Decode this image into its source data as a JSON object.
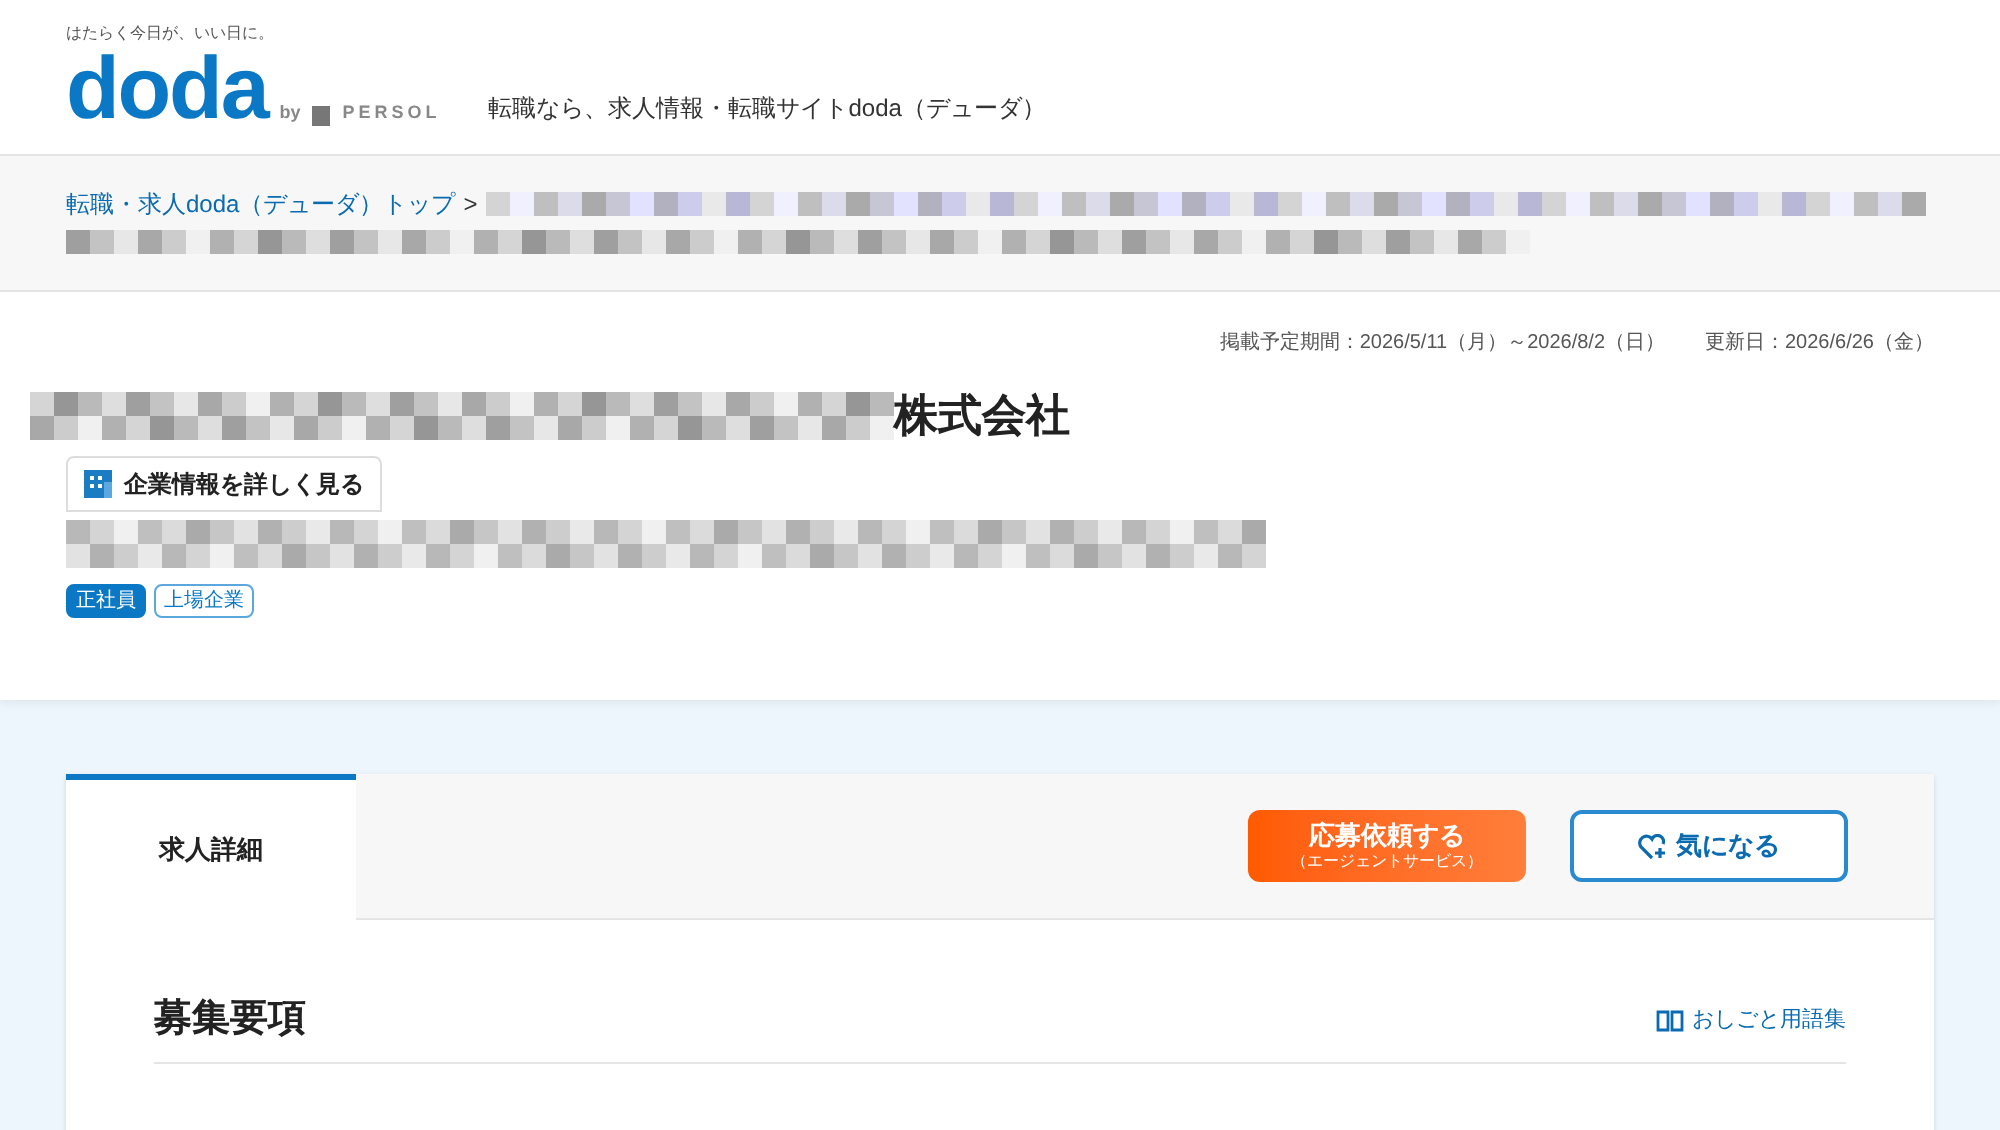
{
  "header": {
    "tagline": "はたらく今日が、いい日に。",
    "logo": "doda",
    "logo_by": "by",
    "logo_brand": "PERSOL",
    "site_title": "転職なら、求人情報・転職サイトdoda（デューダ）"
  },
  "breadcrumb": {
    "items": [
      {
        "label": "転職・求人doda（デューダ）トップ"
      }
    ],
    "separator": ">"
  },
  "posting": {
    "period": "掲載予定期間：2026/5/11（月）～2026/8/2（日）",
    "updated": "更新日：2026/6/26（金）"
  },
  "company": {
    "name_suffix": "株式会社",
    "detail_button": "企業情報を詳しく見る",
    "tags": [
      {
        "label": "正社員",
        "kind": "filled"
      },
      {
        "label": "上場企業",
        "kind": "outline"
      }
    ]
  },
  "tabs": [
    {
      "label": "求人詳細",
      "selected": true
    }
  ],
  "actions": {
    "apply": "応募依頼する",
    "apply_sub": "（エージェントサービス）",
    "favorite": "気になる"
  },
  "section": {
    "title": "募集要項",
    "glossary": "おしごと用語集"
  }
}
